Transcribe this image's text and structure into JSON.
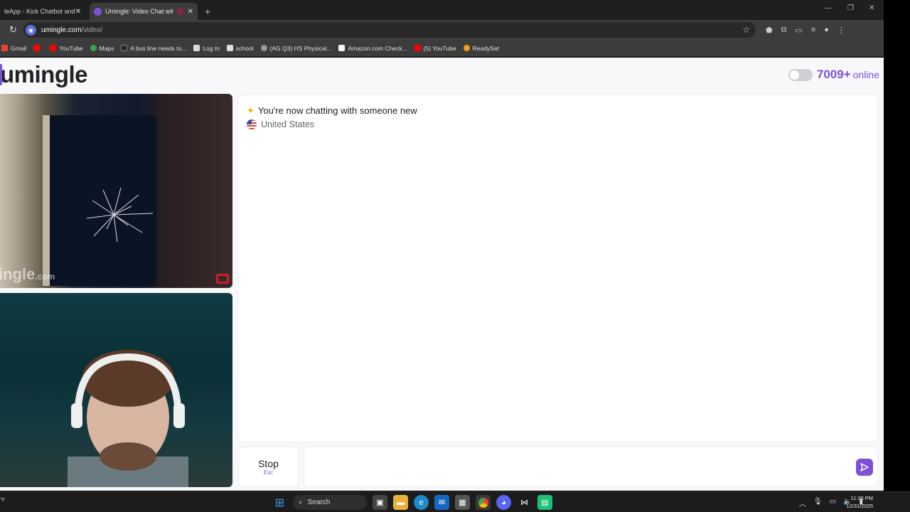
{
  "browser": {
    "tabs": [
      {
        "title": "leApp - Kick Chatbot and",
        "active": false
      },
      {
        "title": "Umingle: Video Chat with S",
        "active": true
      }
    ],
    "url_host": "umingle.com",
    "url_path": "/video/",
    "bookmarks": [
      {
        "label": "Gmail",
        "color": "#ea4335"
      },
      {
        "label": "",
        "color": "#ff0000"
      },
      {
        "label": "YouTube",
        "color": "#ff0000"
      },
      {
        "label": "Maps",
        "color": "#34a853"
      },
      {
        "label": "A bus line needs to...",
        "color": "#222222"
      },
      {
        "label": "Log In",
        "color": "#dddddd"
      },
      {
        "label": "school",
        "color": "#dddddd"
      },
      {
        "label": "(AG Q3) HS Physical...",
        "color": "#999999"
      },
      {
        "label": "Amazon.com Check...",
        "color": "#f5f5f5"
      },
      {
        "label": "(5) YouTube",
        "color": "#ff0000"
      },
      {
        "label": "ReadySet",
        "color": "#f39c12"
      }
    ]
  },
  "site": {
    "logo": "umingle",
    "online_count": "7009+",
    "online_label": "online",
    "accent": "#7b52d6"
  },
  "video": {
    "remote_watermark": "ingle",
    "remote_watermark_suffix": ".com"
  },
  "chat": {
    "system_message": "You're now chatting with someone new",
    "country": "United States",
    "stop_label": "Stop",
    "stop_hint": "Esc",
    "message_placeholder": ""
  },
  "taskbar": {
    "weather_unit": "°F",
    "search_label": "Search",
    "time": "11:35 PM",
    "date": "12/31/2025"
  }
}
